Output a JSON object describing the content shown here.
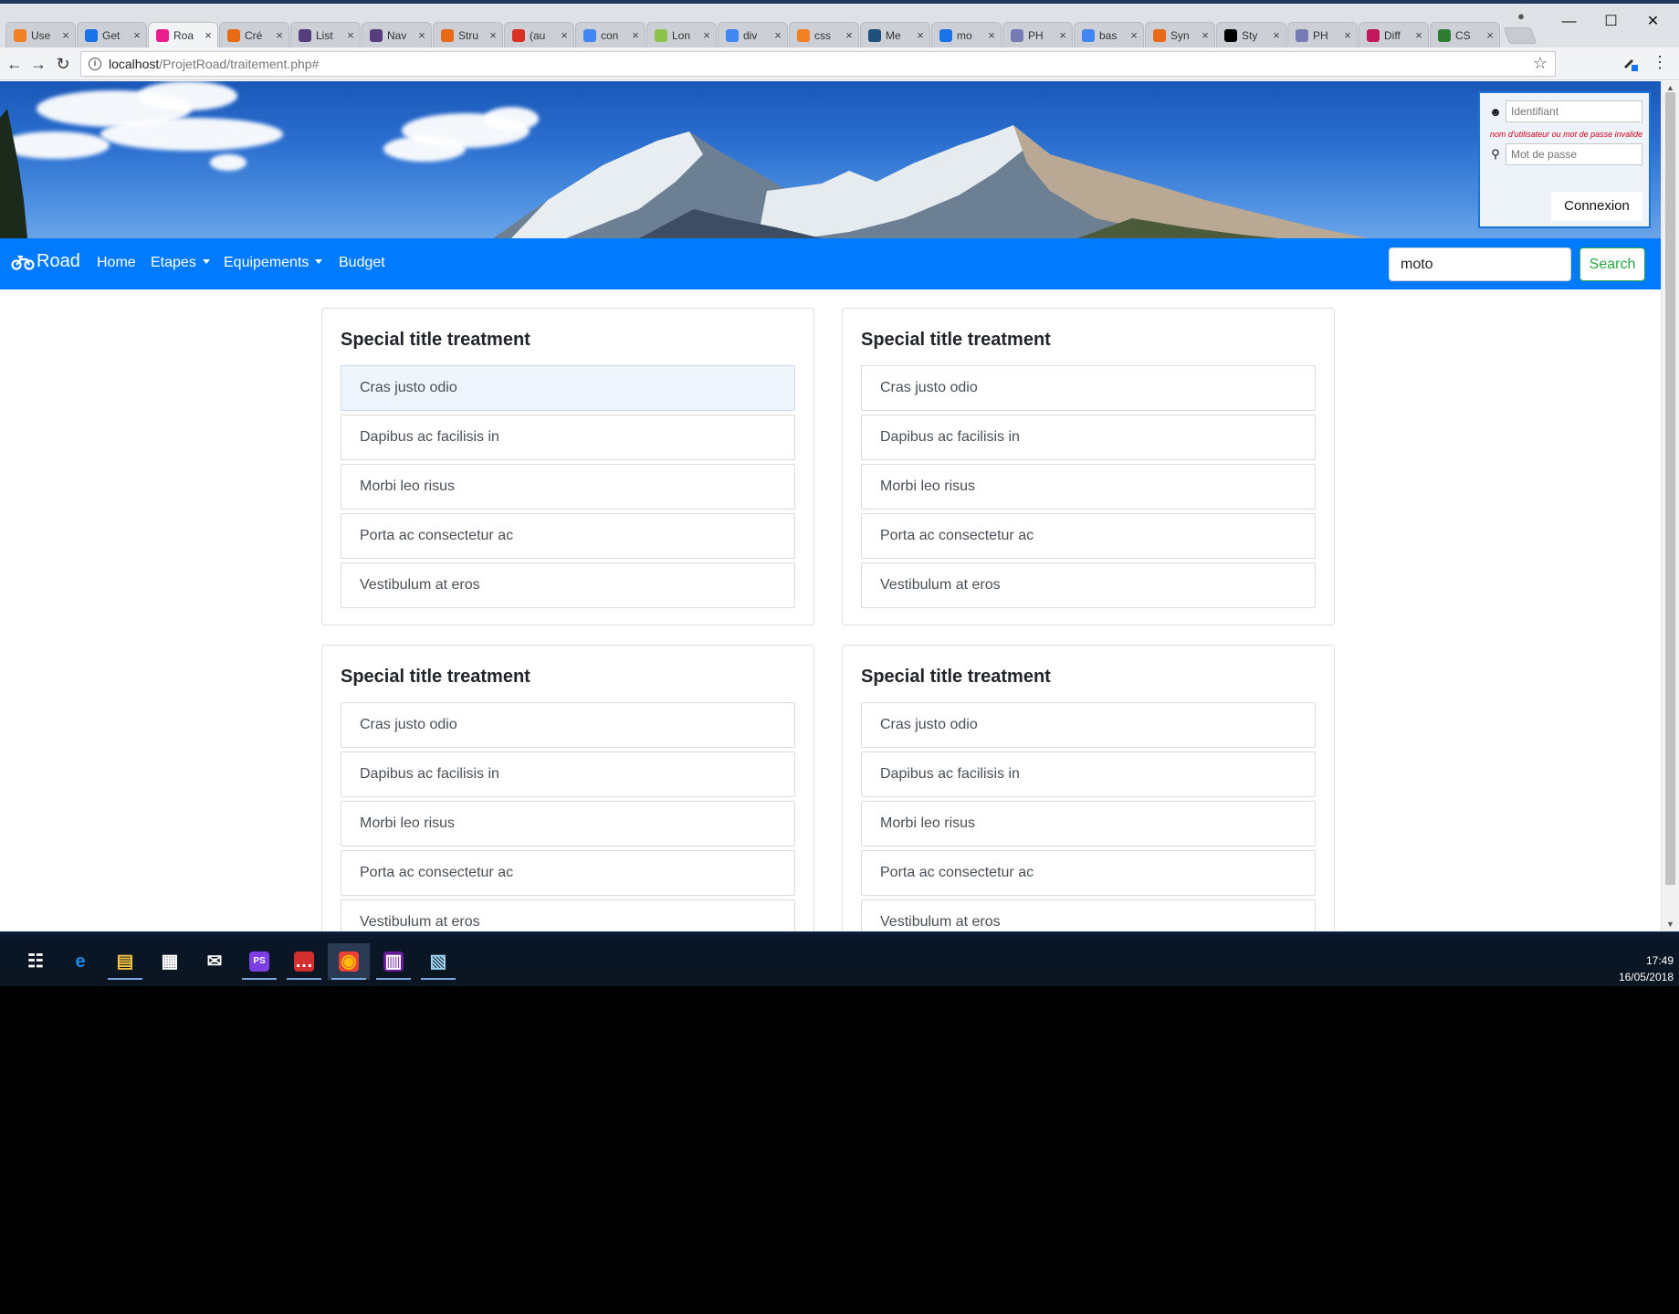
{
  "browser": {
    "tabs": [
      {
        "title": "Use",
        "icon": "stackoverflow-icon",
        "color": "#f48024"
      },
      {
        "title": "Get",
        "icon": "flag-icon",
        "color": "#1a73e8"
      },
      {
        "title": "Roa",
        "icon": "site-icon",
        "color": "#e91e8c",
        "active": true
      },
      {
        "title": "Cré",
        "icon": "openclassrooms-icon",
        "color": "#e86a17"
      },
      {
        "title": "List",
        "icon": "bootstrap-icon",
        "color": "#563d7c"
      },
      {
        "title": "Nav",
        "icon": "bootstrap-icon",
        "color": "#563d7c"
      },
      {
        "title": "Stru",
        "icon": "openclassrooms-icon",
        "color": "#e86a17"
      },
      {
        "title": "(au",
        "icon": "gmail-icon",
        "color": "#d93025"
      },
      {
        "title": "con",
        "icon": "google-icon",
        "color": "#4285f4"
      },
      {
        "title": "Lon",
        "icon": "lorem-icon",
        "color": "#8bc34a"
      },
      {
        "title": "div",
        "icon": "google-icon",
        "color": "#4285f4"
      },
      {
        "title": "css",
        "icon": "stackoverflow-icon",
        "color": "#f48024"
      },
      {
        "title": "Me",
        "icon": "meetup-icon",
        "color": "#1f4e79"
      },
      {
        "title": "mo",
        "icon": "flag-icon",
        "color": "#1a73e8"
      },
      {
        "title": "PH",
        "icon": "php-icon",
        "color": "#777bb3"
      },
      {
        "title": "bas",
        "icon": "google-icon",
        "color": "#4285f4"
      },
      {
        "title": "Syn",
        "icon": "openclassrooms-icon",
        "color": "#e86a17"
      },
      {
        "title": "Sty",
        "icon": "symfony-icon",
        "color": "#000000"
      },
      {
        "title": "PH",
        "icon": "php-icon",
        "color": "#777bb3"
      },
      {
        "title": "Diff",
        "icon": "diff-icon",
        "color": "#c2185b"
      },
      {
        "title": "CS",
        "icon": "css-icon",
        "color": "#2e7d32"
      }
    ],
    "url_host": "localhost",
    "url_path": "/ProjetRoad/traitement.php#"
  },
  "login": {
    "username_placeholder": "Identifiant",
    "password_placeholder": "Mot de passe",
    "error": "nom d'utilisateur ou mot de passe invalide",
    "submit_label": "Connexion"
  },
  "navbar": {
    "brand": "Road",
    "links": {
      "home": "Home",
      "etapes": "Etapes",
      "equipements": "Equipements",
      "budget": "Budget"
    },
    "search_value": "moto",
    "search_button": "Search"
  },
  "cards": [
    {
      "title": "Special title treatment",
      "items": [
        "Cras justo odio",
        "Dapibus ac facilisis in",
        "Morbi leo risus",
        "Porta ac consectetur ac",
        "Vestibulum at eros"
      ]
    },
    {
      "title": "Special title treatment",
      "items": [
        "Cras justo odio",
        "Dapibus ac facilisis in",
        "Morbi leo risus",
        "Porta ac consectetur ac",
        "Vestibulum at eros"
      ]
    },
    {
      "title": "Special title treatment",
      "items": [
        "Cras justo odio",
        "Dapibus ac facilisis in",
        "Morbi leo risus",
        "Porta ac consectetur ac",
        "Vestibulum at eros"
      ]
    },
    {
      "title": "Special title treatment",
      "items": [
        "Cras justo odio",
        "Dapibus ac facilisis in",
        "Morbi leo risus",
        "Porta ac consectetur ac",
        "Vestibulum at eros"
      ]
    }
  ],
  "taskbar": {
    "apps": [
      "task-view-icon",
      "edge-icon",
      "file-explorer-icon",
      "store-icon",
      "mail-icon",
      "phpstorm-icon",
      "chat-icon",
      "chrome-icon",
      "winrar-icon",
      "notes-icon"
    ],
    "time": "17:49",
    "date": "16/05/2018"
  },
  "colors": {
    "navbar": "#007bff",
    "search_button": "#28a745",
    "error": "#d0021b"
  }
}
